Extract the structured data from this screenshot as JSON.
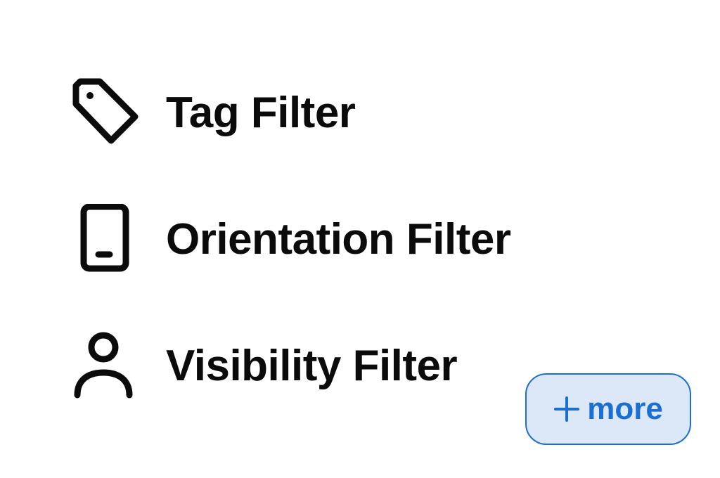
{
  "filters": [
    {
      "label": "Tag Filter",
      "icon": "tag-icon"
    },
    {
      "label": "Orientation Filter",
      "icon": "phone-icon"
    },
    {
      "label": "Visibility Filter",
      "icon": "person-icon"
    }
  ],
  "more_button": {
    "label": "more",
    "icon": "plus-icon"
  },
  "colors": {
    "text": "#0b0b0b",
    "accent": "#1b6fd1",
    "accent_bg": "#dce8f7"
  }
}
